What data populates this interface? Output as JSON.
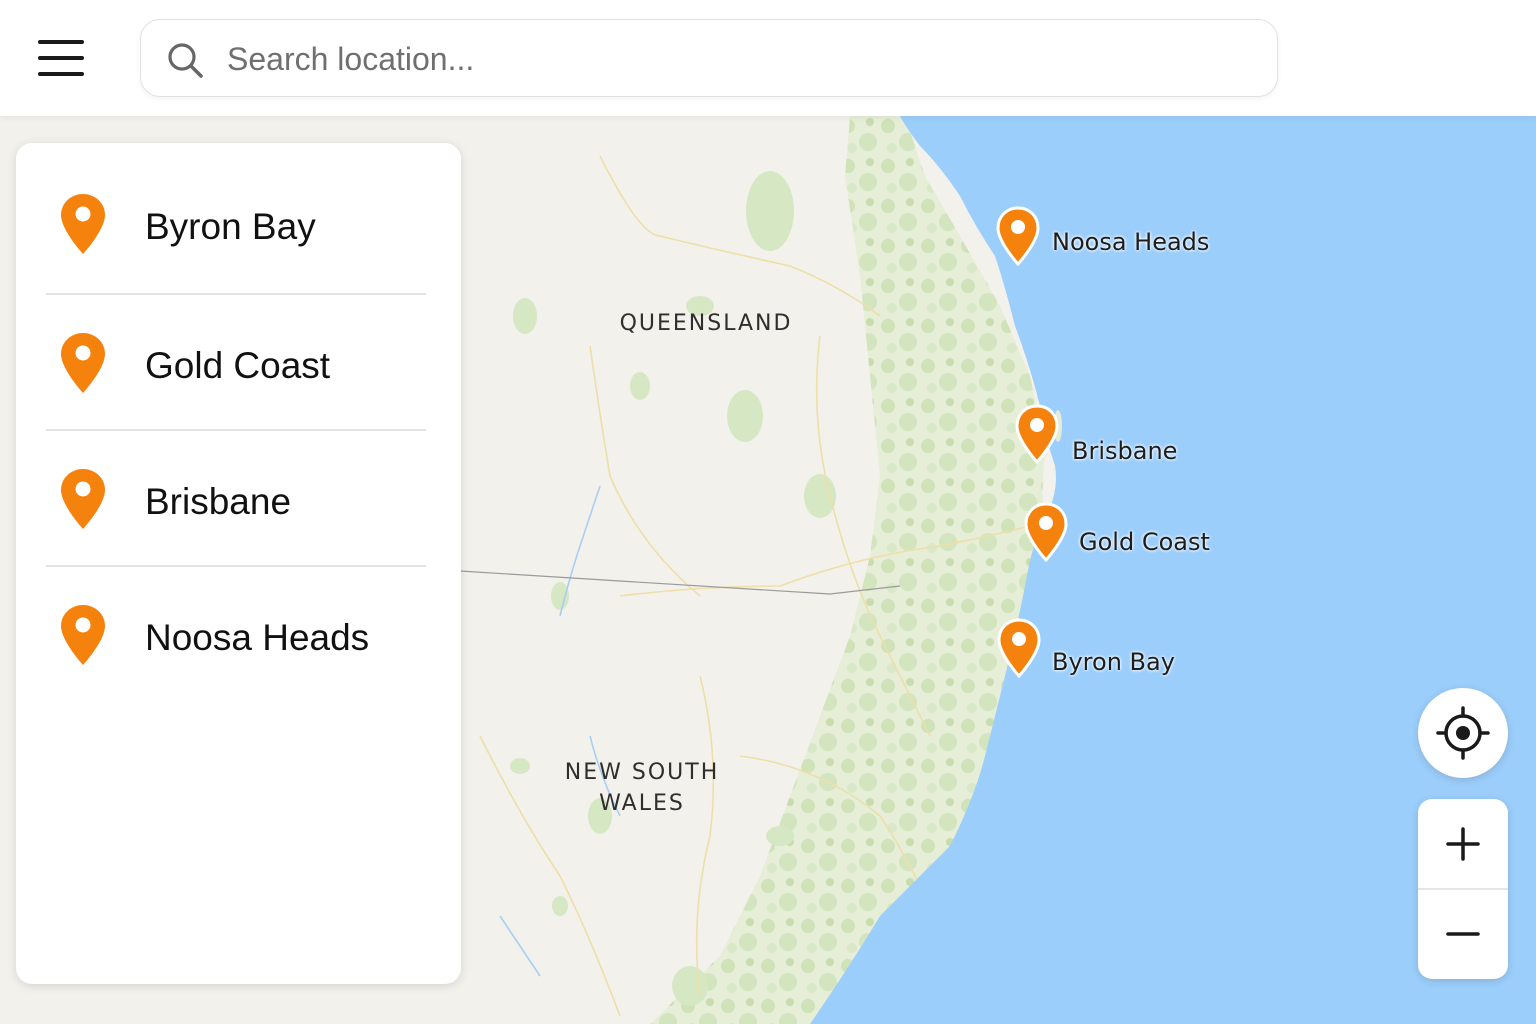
{
  "search": {
    "placeholder": "Search location..."
  },
  "map": {
    "regions": [
      {
        "label": "QUEENSLAND"
      },
      {
        "line1": "NEW SOUTH",
        "line2": "WALES"
      }
    ],
    "markers": [
      {
        "label": "Noosa Heads"
      },
      {
        "label": "Brisbane"
      },
      {
        "label": "Gold Coast"
      },
      {
        "label": "Byron Bay"
      }
    ]
  },
  "sidebar": {
    "items": [
      {
        "label": "Byron Bay"
      },
      {
        "label": "Gold Coast"
      },
      {
        "label": "Brisbane"
      },
      {
        "label": "Noosa Heads"
      }
    ]
  },
  "colors": {
    "marker": "#f5820d",
    "water": "#9ccefb",
    "land": "#f3f1ec",
    "vegetation": "#d5e6c2"
  },
  "icons": {
    "menu": "hamburger-icon",
    "search": "search-icon",
    "marker": "map-pin-icon",
    "locate": "crosshair-icon",
    "zoom_in": "plus-icon",
    "zoom_out": "minus-icon"
  }
}
